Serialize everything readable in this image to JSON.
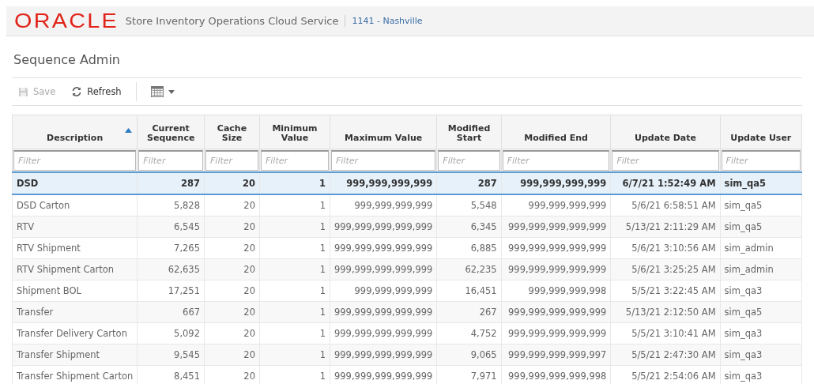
{
  "header": {
    "logo": "ORACLE",
    "app_title": "Store Inventory Operations Cloud Service",
    "store": "1141 - Nashville"
  },
  "page_title": "Sequence Admin",
  "toolbar": [
    {
      "kind": "save",
      "label": "Save",
      "disabled": true
    },
    {
      "kind": "refresh",
      "label": "Refresh",
      "disabled": false
    },
    {
      "kind": "columns"
    }
  ],
  "table": {
    "columns": [
      {
        "label": "Description",
        "kind": "text",
        "sorted": true,
        "placeholder": "Filter"
      },
      {
        "label": "Current Sequence",
        "kind": "number",
        "sorted": false,
        "placeholder": "Filter"
      },
      {
        "label": "Cache Size",
        "kind": "number",
        "sorted": false,
        "placeholder": "Filter"
      },
      {
        "label": "Minimum Value",
        "kind": "number",
        "sorted": false,
        "placeholder": "Filter"
      },
      {
        "label": "Maximum Value",
        "kind": "number",
        "sorted": false,
        "placeholder": "Filter"
      },
      {
        "label": "Modified Start",
        "kind": "number",
        "sorted": false,
        "placeholder": "Filter"
      },
      {
        "label": "Modified End",
        "kind": "number",
        "sorted": false,
        "placeholder": "Filter"
      },
      {
        "label": "Update Date",
        "kind": "number",
        "sorted": false,
        "placeholder": "Filter"
      },
      {
        "label": "Update User",
        "kind": "text",
        "sorted": false,
        "placeholder": "Filter"
      }
    ],
    "rows": [
      {
        "selected": true,
        "cells": [
          "DSD",
          "287",
          "20",
          "1",
          "999,999,999,999",
          "287",
          "999,999,999,999",
          "6/7/21 1:52:49 AM",
          "sim_qa5"
        ]
      },
      {
        "selected": false,
        "cells": [
          "DSD Carton",
          "5,828",
          "20",
          "1",
          "999,999,999,999",
          "5,548",
          "999,999,999,999",
          "5/6/21 6:58:51 AM",
          "sim_qa5"
        ]
      },
      {
        "selected": false,
        "cells": [
          "RTV",
          "6,545",
          "20",
          "1",
          "999,999,999,999,999",
          "6,345",
          "999,999,999,999,999",
          "5/13/21 2:11:29 AM",
          "sim_qa5"
        ]
      },
      {
        "selected": false,
        "cells": [
          "RTV Shipment",
          "7,265",
          "20",
          "1",
          "999,999,999,999,999",
          "6,885",
          "999,999,999,999,999",
          "5/6/21 3:10:56 AM",
          "sim_admin"
        ]
      },
      {
        "selected": false,
        "cells": [
          "RTV Shipment Carton",
          "62,635",
          "20",
          "1",
          "999,999,999,999,999",
          "62,235",
          "999,999,999,999,999",
          "5/6/21 3:25:25 AM",
          "sim_admin"
        ]
      },
      {
        "selected": false,
        "cells": [
          "Shipment BOL",
          "17,251",
          "20",
          "1",
          "999,999,999,999",
          "16,451",
          "999,999,999,998",
          "5/5/21 3:22:45 AM",
          "sim_qa3"
        ]
      },
      {
        "selected": false,
        "cells": [
          "Transfer",
          "667",
          "20",
          "1",
          "999,999,999,999,999",
          "267",
          "999,999,999,999,999",
          "5/13/21 2:12:50 AM",
          "sim_qa5"
        ]
      },
      {
        "selected": false,
        "cells": [
          "Transfer Delivery Carton",
          "5,092",
          "20",
          "1",
          "999,999,999,999,999",
          "4,752",
          "999,999,999,999,999",
          "5/5/21 3:10:41 AM",
          "sim_qa3"
        ]
      },
      {
        "selected": false,
        "cells": [
          "Transfer Shipment",
          "9,545",
          "20",
          "1",
          "999,999,999,999,999",
          "9,065",
          "999,999,999,999,997",
          "5/5/21 2:47:30 AM",
          "sim_qa3"
        ]
      },
      {
        "selected": false,
        "cells": [
          "Transfer Shipment Carton",
          "8,451",
          "20",
          "1",
          "999,999,999,999,999",
          "7,971",
          "999,999,999,999,998",
          "5/5/21 2:54:06 AM",
          "sim_qa3"
        ]
      }
    ]
  }
}
